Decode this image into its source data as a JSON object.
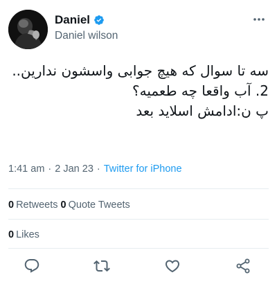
{
  "author": {
    "display_name": "Daniel",
    "handle": "Daniel wilson",
    "verified_icon": "verified-badge-icon"
  },
  "tweet": {
    "text": "سه تا سوال که هیچ جوابی واسشون ندارین..\n2.  آب واقعا چه طعمیه؟\nپ ن:ادامش اسلاید بعد",
    "time": "1:41 am",
    "date": "2 Jan 23",
    "separator": "·",
    "source": "Twitter for iPhone"
  },
  "stats": {
    "retweets_count": "0",
    "retweets_label": "Retweets",
    "quotes_count": "0",
    "quotes_label": "Quote Tweets",
    "likes_count": "0",
    "likes_label": "Likes"
  },
  "colors": {
    "accent": "#1d9bf0",
    "secondary_text": "#536471",
    "divider": "#e6ecf0"
  },
  "icons": [
    "more-icon",
    "reply-icon",
    "retweet-icon",
    "like-icon",
    "share-icon"
  ]
}
